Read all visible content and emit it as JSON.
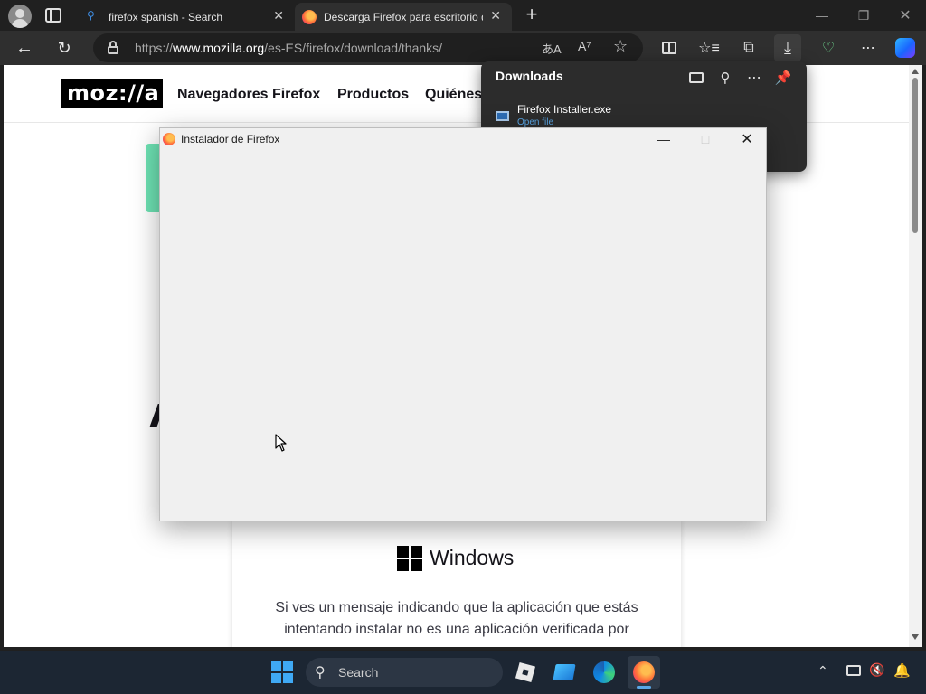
{
  "browser": {
    "tabs": [
      {
        "label": "firefox spanish - Search",
        "active": false
      },
      {
        "label": "Descarga Firefox para escritorio d",
        "active": true
      }
    ],
    "url": {
      "prefix": "https://",
      "host": "www.mozilla.org",
      "path": "/es-ES/firefox/download/thanks/"
    }
  },
  "page": {
    "logo": "moz://a",
    "nav": [
      "Navegadores Firefox",
      "Productos",
      "Quiénes"
    ],
    "card": {
      "title": "Windows",
      "text": "Si ves un mensaje indicando que la aplicación que estás intentando instalar no es una aplicación verificada por"
    }
  },
  "downloads": {
    "title": "Downloads",
    "file": "Firefox Installer.exe",
    "action": "Open file"
  },
  "installer": {
    "title": "Instalador de Firefox"
  },
  "taskbar": {
    "search_placeholder": "Search"
  },
  "colors": {
    "accent": "#5aa7e6",
    "taskbar": "#1c2633",
    "firefox_orange": "#ff7139"
  }
}
